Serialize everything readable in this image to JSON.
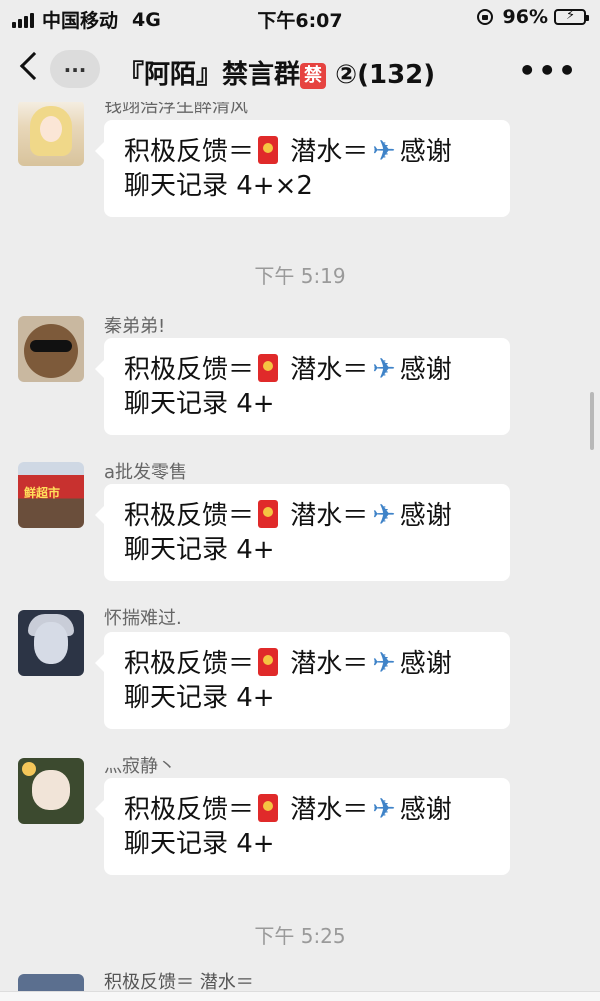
{
  "status_bar": {
    "carrier": "中国移动",
    "network": "4G",
    "time": "下午6:07",
    "battery_percent": "96%",
    "battery_level": 0.96,
    "battery_color": "#2dbd3f"
  },
  "nav": {
    "back_icon": "chevron-left-icon",
    "unread_label": "...",
    "title_prefix": "『阿陌』禁言群",
    "title_badge": "禁",
    "title_suffix": "②(132)",
    "more_label": "•••"
  },
  "messages": [
    {
      "sender": "钱翊浩浮生醉清风",
      "text_part1": "积极反馈＝",
      "text_part2": " 潜水＝",
      "text_part3": "感谢",
      "text_line2": "聊天记录 4+×2"
    },
    {
      "sender": "秦弟弟!",
      "text_part1": "积极反馈＝",
      "text_part2": " 潜水＝",
      "text_part3": "感谢",
      "text_line2": "聊天记录 4+"
    },
    {
      "sender": "a批发零售",
      "text_part1": "积极反馈＝",
      "text_part2": " 潜水＝",
      "text_part3": "感谢",
      "text_line2": "聊天记录 4+"
    },
    {
      "sender": "怀揣难过.",
      "text_part1": "积极反馈＝",
      "text_part2": " 潜水＝",
      "text_part3": "感谢",
      "text_line2": "聊天记录 4+"
    },
    {
      "sender": "灬寂静丶",
      "text_part1": "积极反馈＝",
      "text_part2": " 潜水＝",
      "text_part3": "感谢",
      "text_line2": "聊天记录 4+"
    }
  ],
  "timestamps": {
    "t1": "下午 5:19",
    "t2": "下午 5:25"
  },
  "partial_message": {
    "text": "积极反馈＝ 潜水＝"
  },
  "avatar3_sign": "鲜超市",
  "icons": {
    "red_packet": "red-packet-emoji",
    "airplane": "airplane-emoji"
  }
}
